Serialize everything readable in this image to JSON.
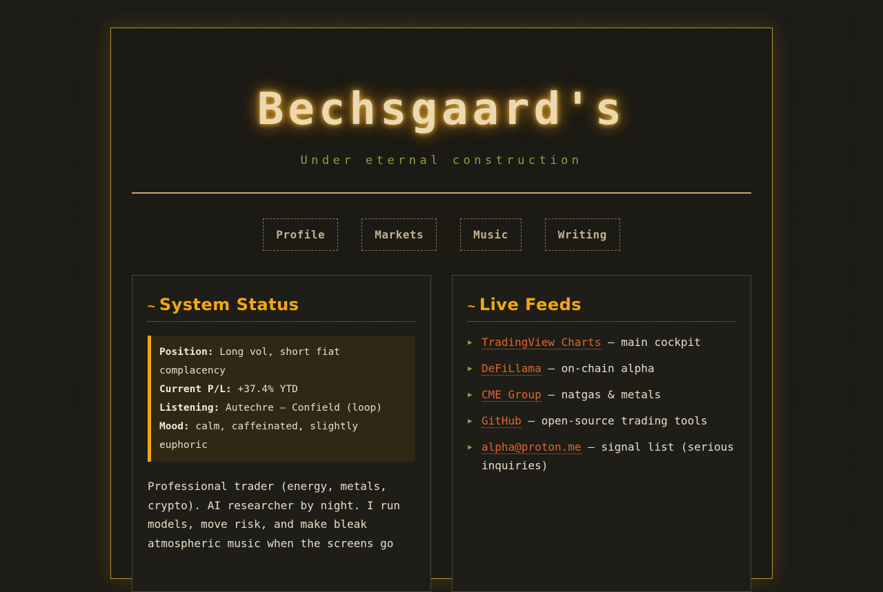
{
  "header": {
    "title": "Bechsgaard's",
    "subtitle": "Under eternal construction"
  },
  "nav": [
    {
      "label": "Profile"
    },
    {
      "label": "Markets"
    },
    {
      "label": "Music"
    },
    {
      "label": "Writing"
    }
  ],
  "status_panel": {
    "tilde": "~",
    "heading": "System Status",
    "items": [
      {
        "key": "Position",
        "value": " Long vol, short fiat complacency"
      },
      {
        "key": "Current P/L",
        "value": " +37.4% YTD"
      },
      {
        "key": "Listening",
        "value": " Autechre – Confield (loop)"
      },
      {
        "key": "Mood",
        "value": " calm, caffeinated, slightly euphoric"
      }
    ],
    "separator": ":",
    "bio": "Professional trader (energy, metals, crypto). AI researcher by night. I run models, move risk, and make bleak atmospheric music when the screens go"
  },
  "feeds_panel": {
    "tilde": "~",
    "heading": "Live Feeds",
    "bullet_icon": "triangle-right-icon",
    "items": [
      {
        "link": "TradingView Charts",
        "desc": " — main cockpit"
      },
      {
        "link": "DeFiLlama",
        "desc": " — on-chain alpha"
      },
      {
        "link": "CME Group",
        "desc": " — natgas & metals"
      },
      {
        "link": "GitHub",
        "desc": " — open-source trading tools"
      },
      {
        "link": "alpha@proton.me",
        "desc": " — signal list (serious inquiries)"
      }
    ]
  },
  "colors": {
    "accent": "#f2a813",
    "link": "#e0662e",
    "subtitle": "#8fa03a",
    "frame_border": "#b8913a"
  }
}
